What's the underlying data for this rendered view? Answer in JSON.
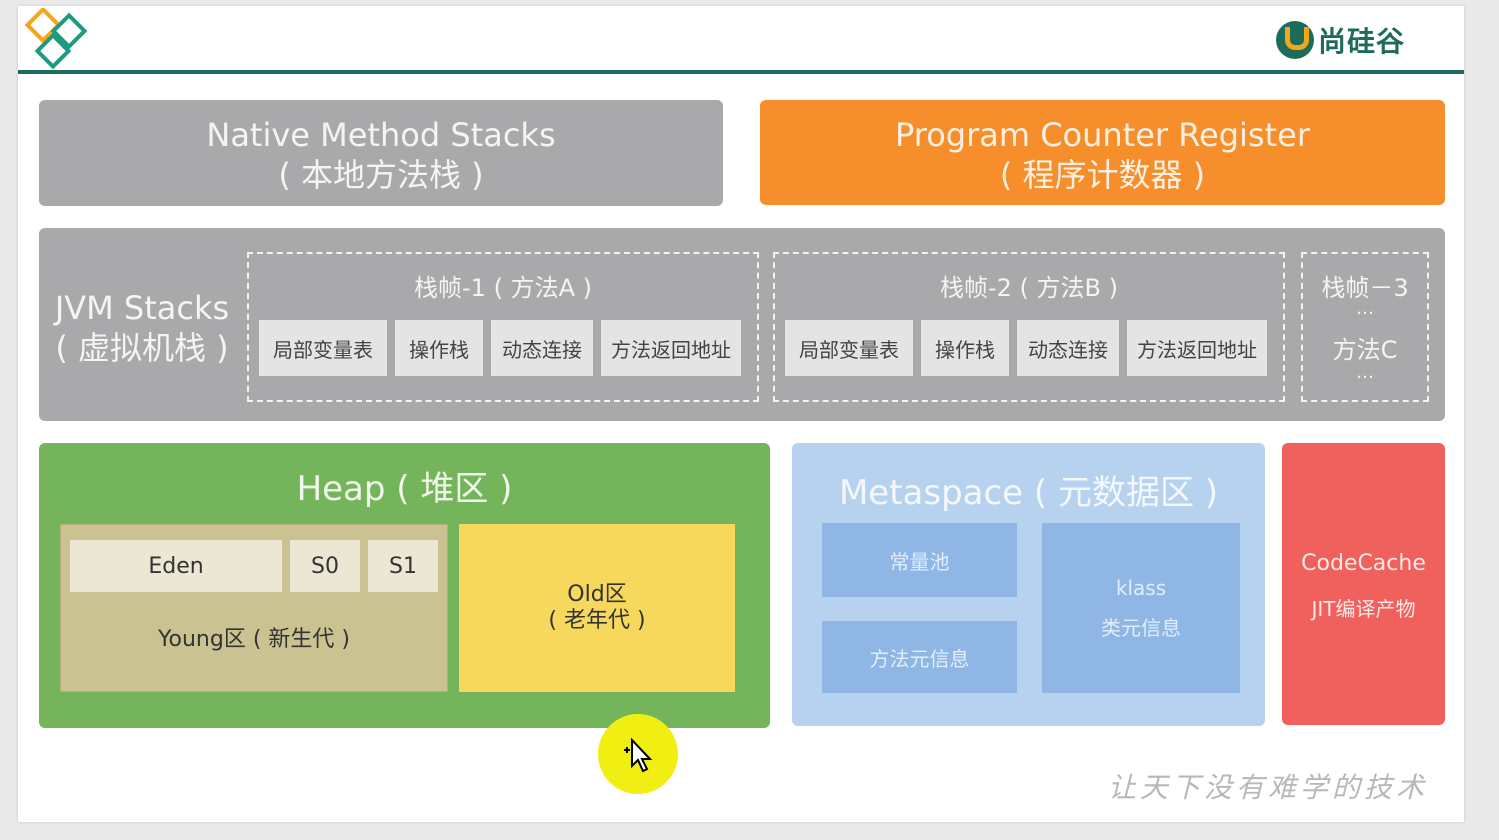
{
  "brand": {
    "name": "尚硅谷",
    "motto": "让天下没有难学的技术"
  },
  "native_method_stacks": {
    "title": "Native Method Stacks",
    "subtitle": "( 本地方法栈 )"
  },
  "program_counter": {
    "title": "Program Counter Register",
    "subtitle": "( 程序计数器 )"
  },
  "jvm_stacks": {
    "title": "JVM Stacks",
    "subtitle": "( 虚拟机栈 )",
    "frames": [
      {
        "title": "栈帧-1 ( 方法A )",
        "cells": [
          "局部变量表",
          "操作栈",
          "动态连接",
          "方法返回地址"
        ]
      },
      {
        "title": "栈帧-2 ( 方法B )",
        "cells": [
          "局部变量表",
          "操作栈",
          "动态连接",
          "方法返回地址"
        ]
      },
      {
        "title": "栈帧－3",
        "dots1": "…",
        "method": "方法C",
        "dots2": "…"
      }
    ]
  },
  "heap": {
    "title": "Heap ( 堆区 )",
    "young": {
      "eden": "Eden",
      "s0": "S0",
      "s1": "S1",
      "label": "Young区 ( 新生代 )"
    },
    "old": {
      "line1": "Old区",
      "line2": "( 老年代 )"
    }
  },
  "metaspace": {
    "title": "Metaspace ( 元数据区 )",
    "constant_pool": "常量池",
    "method_meta": "方法元信息",
    "klass": "klass",
    "class_meta": "类元信息"
  },
  "code_cache": {
    "title": "CodeCache",
    "subtitle": "JIT编译产物"
  },
  "colors": {
    "gray": "#a9a9ab",
    "orange": "#f58e2b",
    "green": "#74b45a",
    "blue": "#b7d2ef",
    "red": "#f0605c",
    "yellow": "#f5d85c",
    "khaki": "#cbc292",
    "teal": "#1d6b5a"
  },
  "icons": {
    "logo": "diamond-logo-icon",
    "brand": "brand-u-icon",
    "cursor": "move-cursor-icon"
  }
}
